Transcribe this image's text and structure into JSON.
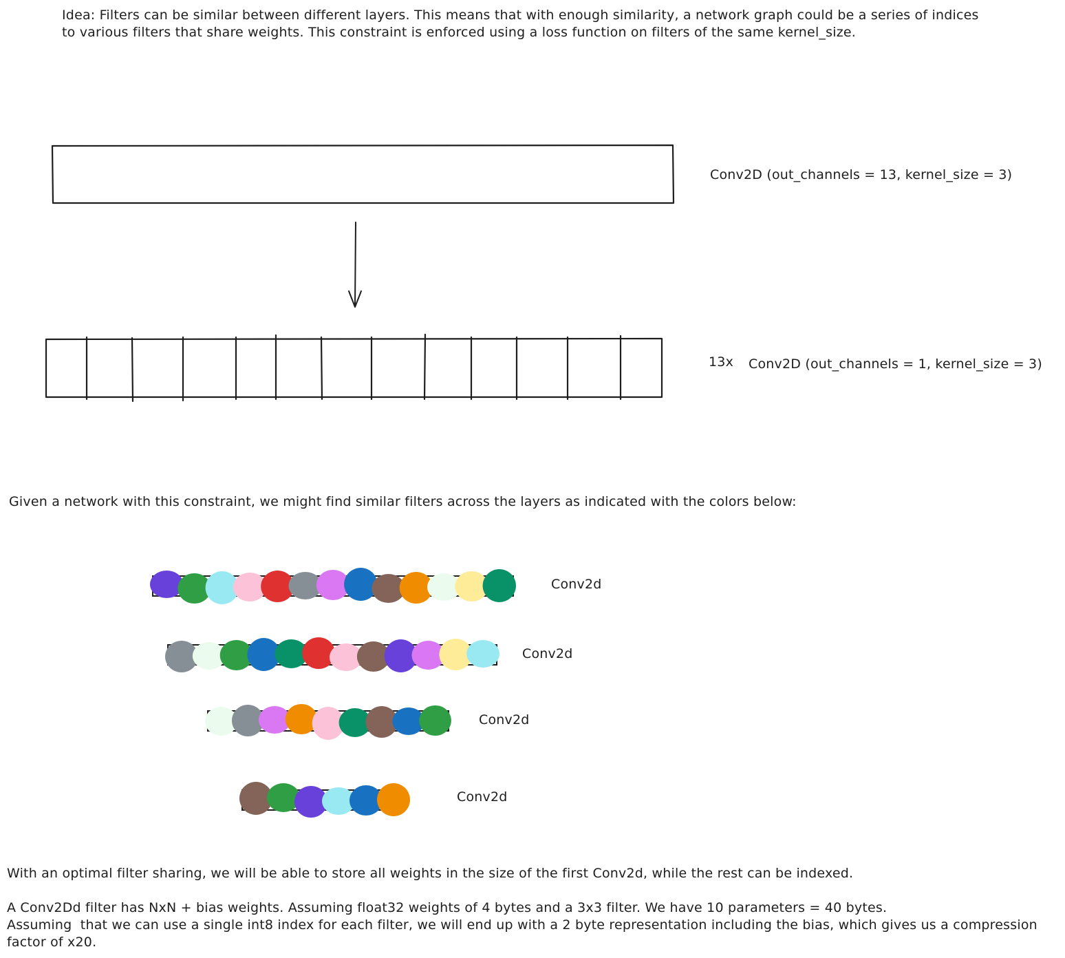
{
  "header": {
    "idea_line1": "Idea: Filters can be similar between different layers. This means that with enough similarity, a network graph could be a series of indices",
    "idea_line2": "to various filters that share weights. This constraint is enforced using a loss function on filters of the same kernel_size."
  },
  "diagram": {
    "top_label": "Conv2D (out_channels = 13, kernel_size = 3)",
    "split_count": "13x",
    "split_label": "Conv2D (out_channels = 1, kernel_size = 3)",
    "given_text": "Given a network with this constraint, we might find similar filters across the layers as indicated with the colors below:",
    "layers": [
      {
        "label": "Conv2d",
        "colors": [
          "#6741d9",
          "#2f9e44",
          "#99e9f2",
          "#fcc2d7",
          "#e03131",
          "#868e96",
          "#da77f2",
          "#1971c2",
          "#846358",
          "#f08c00",
          "#ebfbee",
          "#ffec99",
          "#099268"
        ]
      },
      {
        "label": "Conv2d",
        "colors": [
          "#868e96",
          "#ebfbee",
          "#2f9e44",
          "#1971c2",
          "#099268",
          "#e03131",
          "#fcc2d7",
          "#846358",
          "#6741d9",
          "#da77f2",
          "#ffec99",
          "#99e9f2"
        ]
      },
      {
        "label": "Conv2d",
        "colors": [
          "#ebfbee",
          "#868e96",
          "#da77f2",
          "#f08c00",
          "#fcc2d7",
          "#099268",
          "#846358",
          "#1971c2",
          "#2f9e44"
        ]
      },
      {
        "label": "Conv2d",
        "colors": [
          "#846358",
          "#2f9e44",
          "#6741d9",
          "#99e9f2",
          "#1971c2",
          "#f08c00"
        ]
      }
    ]
  },
  "footer": {
    "line1": "With an optimal filter sharing, we will be able to store all weights in the size of the first Conv2d, while the rest can be indexed.",
    "line2": "A Conv2Dd filter has NxN + bias weights. Assuming float32 weights of 4 bytes and a 3x3 filter. We have 10 parameters = 40 bytes.",
    "line3": "Assuming  that we can use a single int8 index for each filter, we will end up with a 2 byte representation including the bias, which gives us a compression",
    "line4": "factor of x20."
  }
}
